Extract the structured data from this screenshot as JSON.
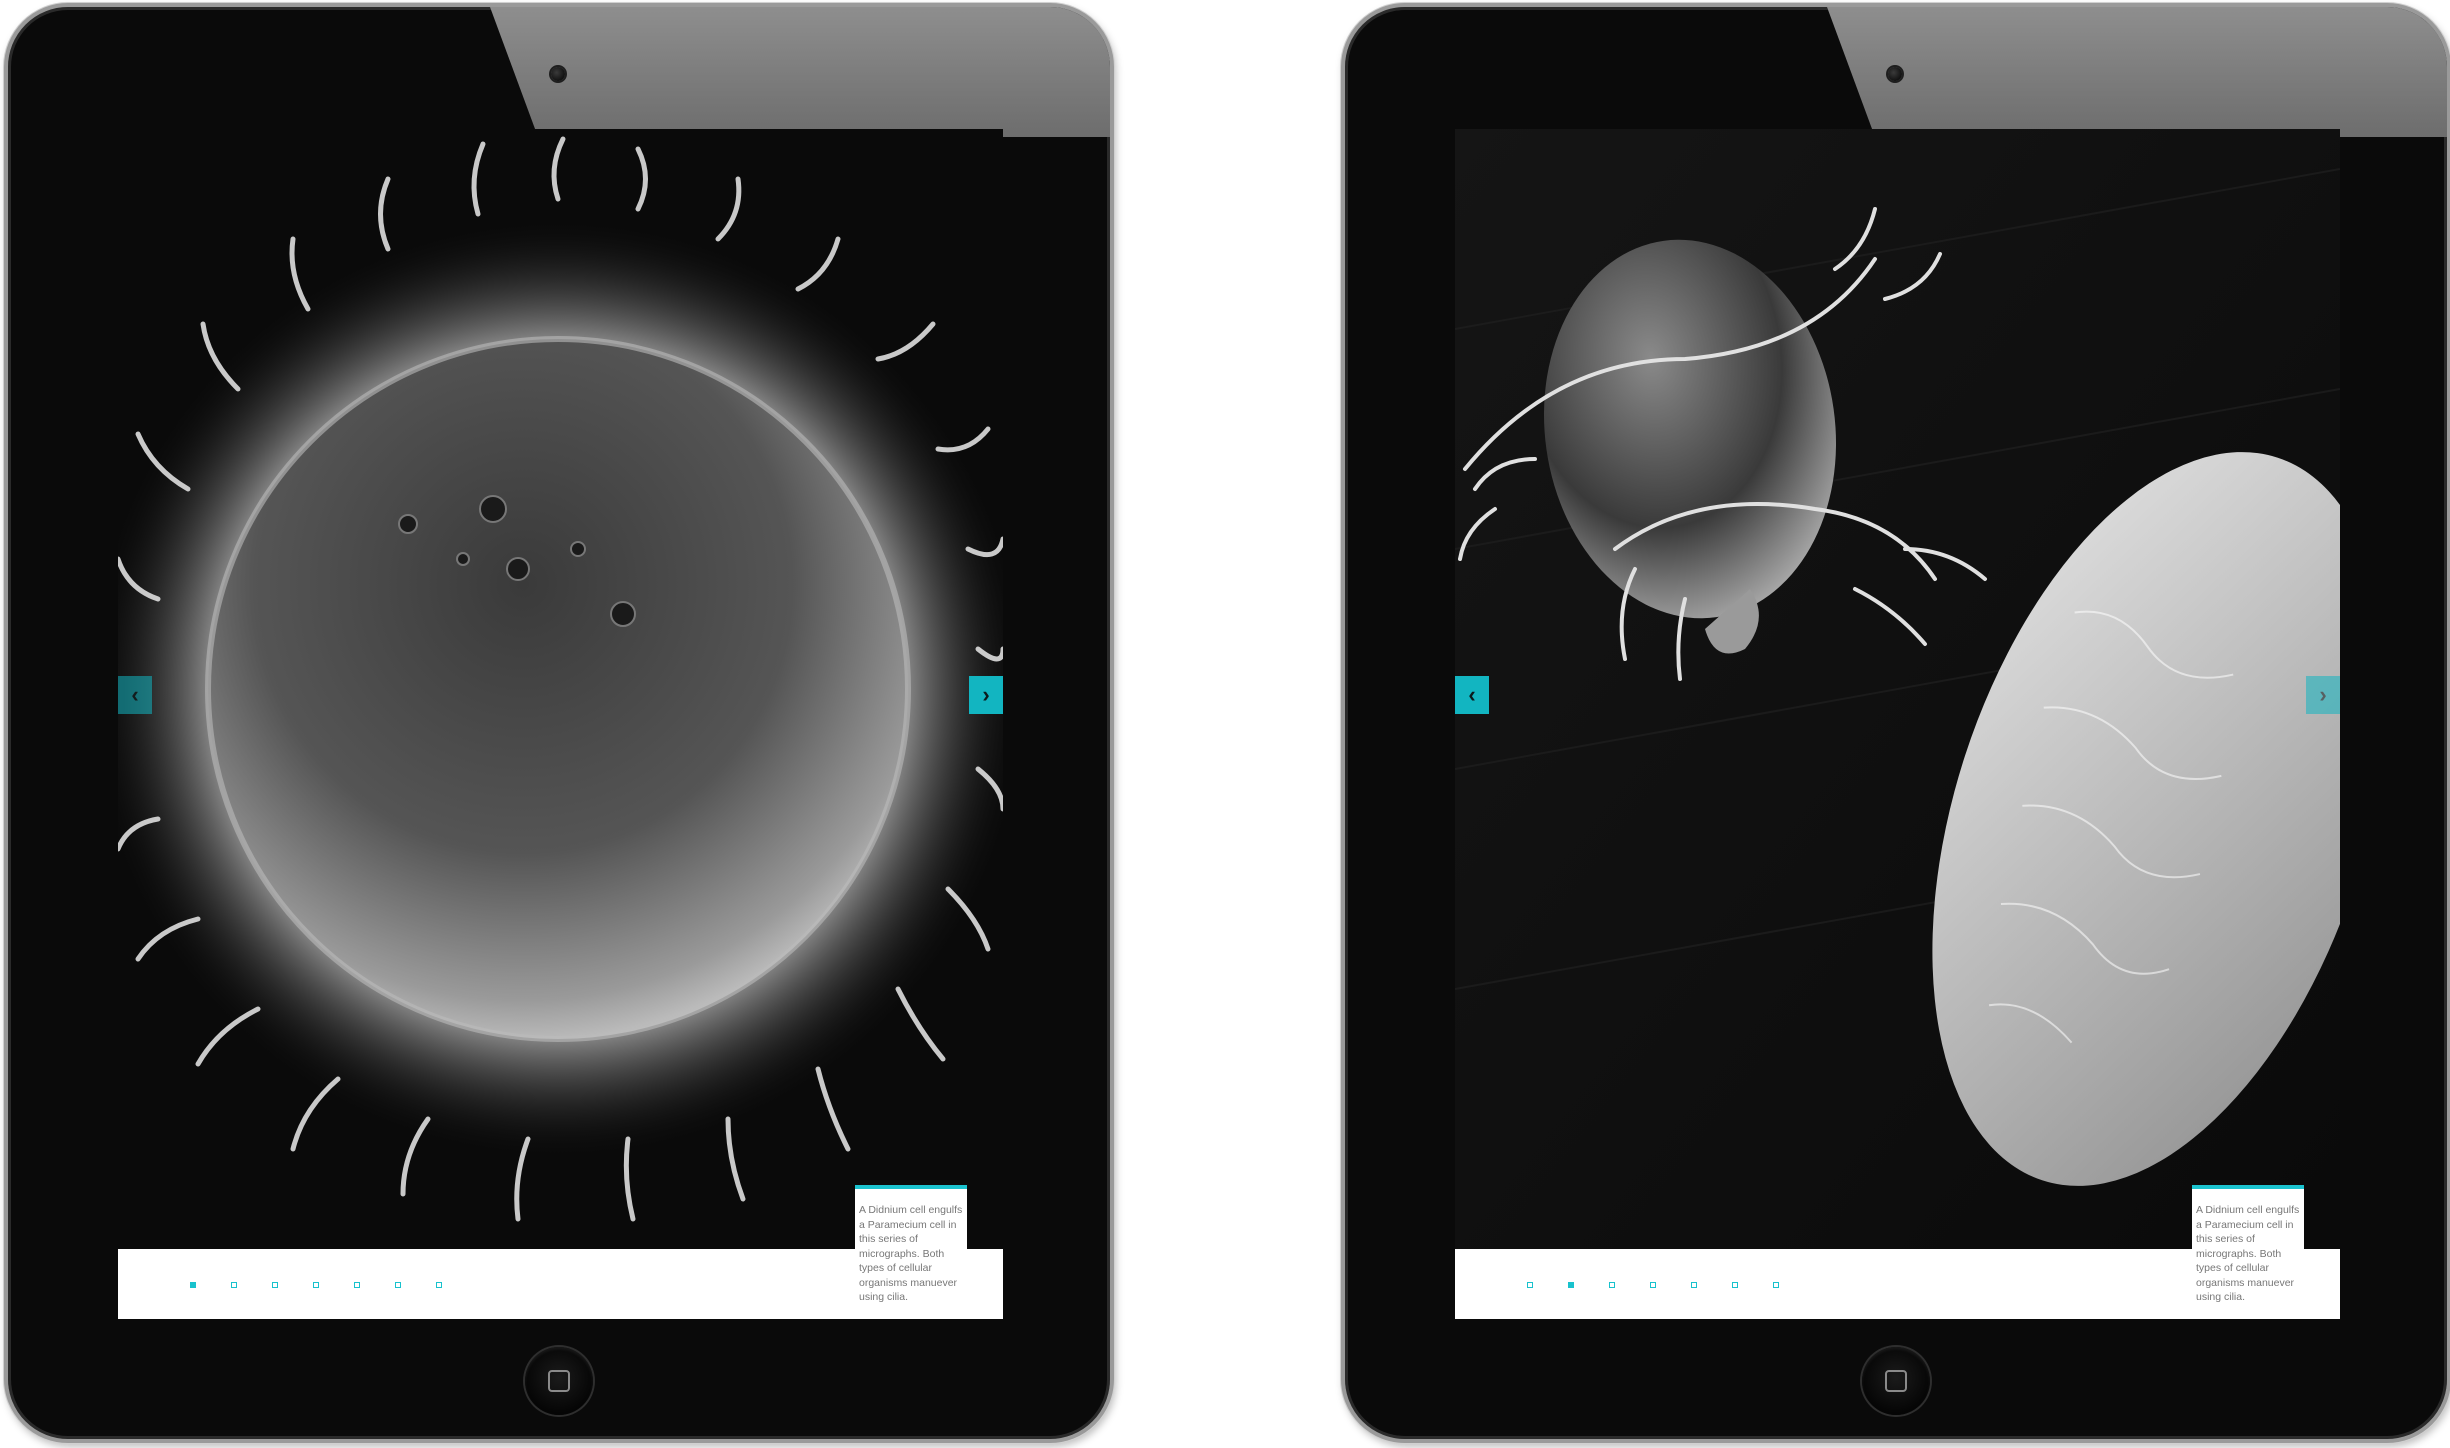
{
  "devices": [
    {
      "id": "left",
      "prev_arrow": "‹",
      "next_arrow": "›",
      "caption": "A Didnium cell engulfs a Paramecium cell in this series of micrographs. Both types of cellular organisms manuever using cilia.",
      "pagination": {
        "total": 7,
        "active": 1
      }
    },
    {
      "id": "right",
      "prev_arrow": "‹",
      "next_arrow": "›",
      "caption": "A Didnium cell engulfs a Paramecium cell in this series of micrographs. Both types of cellular organisms manuever using cilia.",
      "pagination": {
        "total": 7,
        "active": 2
      }
    }
  ],
  "colors": {
    "accent": "#18c2cd",
    "bezel": "#0a0a0a",
    "footer": "#ffffff"
  },
  "icons": [
    "camera-icon",
    "home-button-icon",
    "chevron-left-icon",
    "chevron-right-icon"
  ]
}
